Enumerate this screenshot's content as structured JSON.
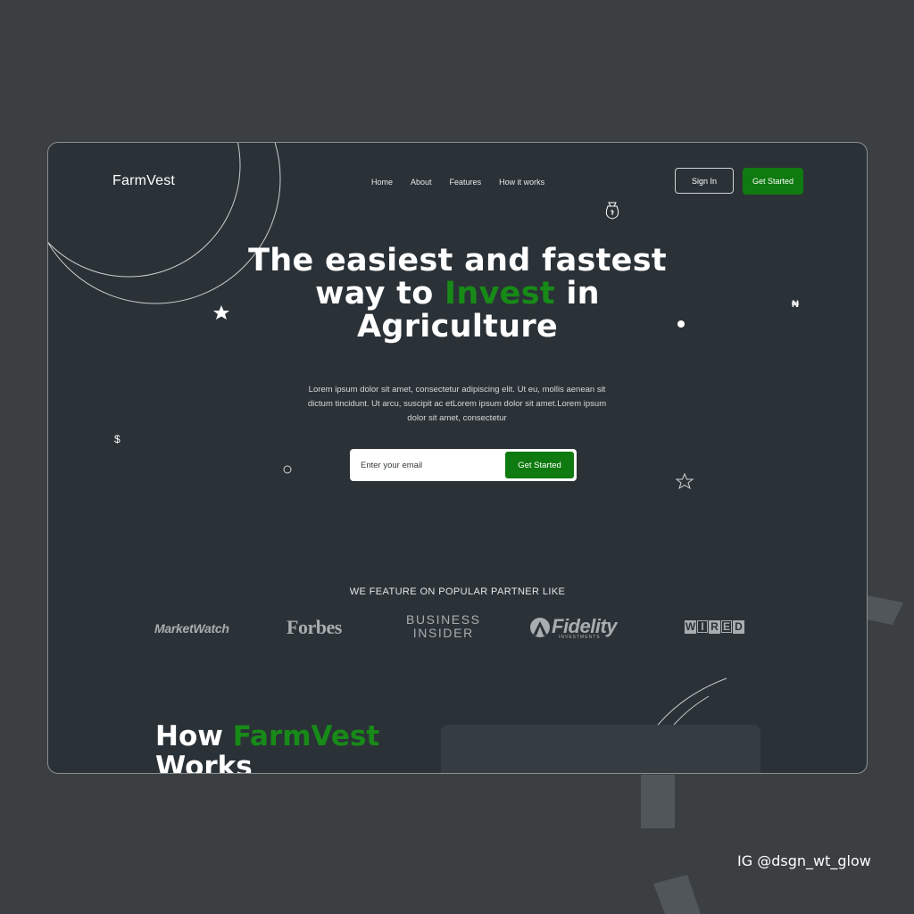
{
  "brand": {
    "name": "FarmVest"
  },
  "nav": {
    "items": [
      {
        "label": "Home"
      },
      {
        "label": "About"
      },
      {
        "label": "Features"
      },
      {
        "label": "How it works"
      }
    ]
  },
  "header": {
    "sign_in_label": "Sign In",
    "get_started_label": "Get Started"
  },
  "hero": {
    "title_part1": "The easiest and fastest",
    "title_part2": "way to ",
    "title_accent": "Invest",
    "title_part3": " in",
    "title_part4": "Agriculture",
    "description": "Lorem ipsum dolor sit amet, consectetur adipiscing elit. Ut eu, mollis aenean sit dictum tincidunt. Ut arcu, suscipit ac etLorem ipsum dolor sit amet.Lorem ipsum dolor sit amet, consectetur",
    "email_placeholder": "Enter your email",
    "email_button_label": "Get Started"
  },
  "decor": {
    "dollar": "$",
    "naira": "₦"
  },
  "partners": {
    "heading": "WE FEATURE ON POPULAR PARTNER LIKE",
    "logos": {
      "marketwatch": "MarketWatch",
      "forbes": "Forbes",
      "bi_line1": "BUSINESS",
      "bi_line2": "INSIDER",
      "fidelity": "Fidelity",
      "fidelity_sub": "INVESTMENTS",
      "wired": [
        "W",
        "I",
        "R",
        "E",
        "D"
      ]
    }
  },
  "how": {
    "title_part1": "How ",
    "title_accent": "FarmVest",
    "title_part2": "Works"
  },
  "watermark": "IG @dsgn_wt_glow",
  "colors": {
    "accent": "#0f7a0f",
    "background": "#3b3f41",
    "card": "#2b3237"
  }
}
